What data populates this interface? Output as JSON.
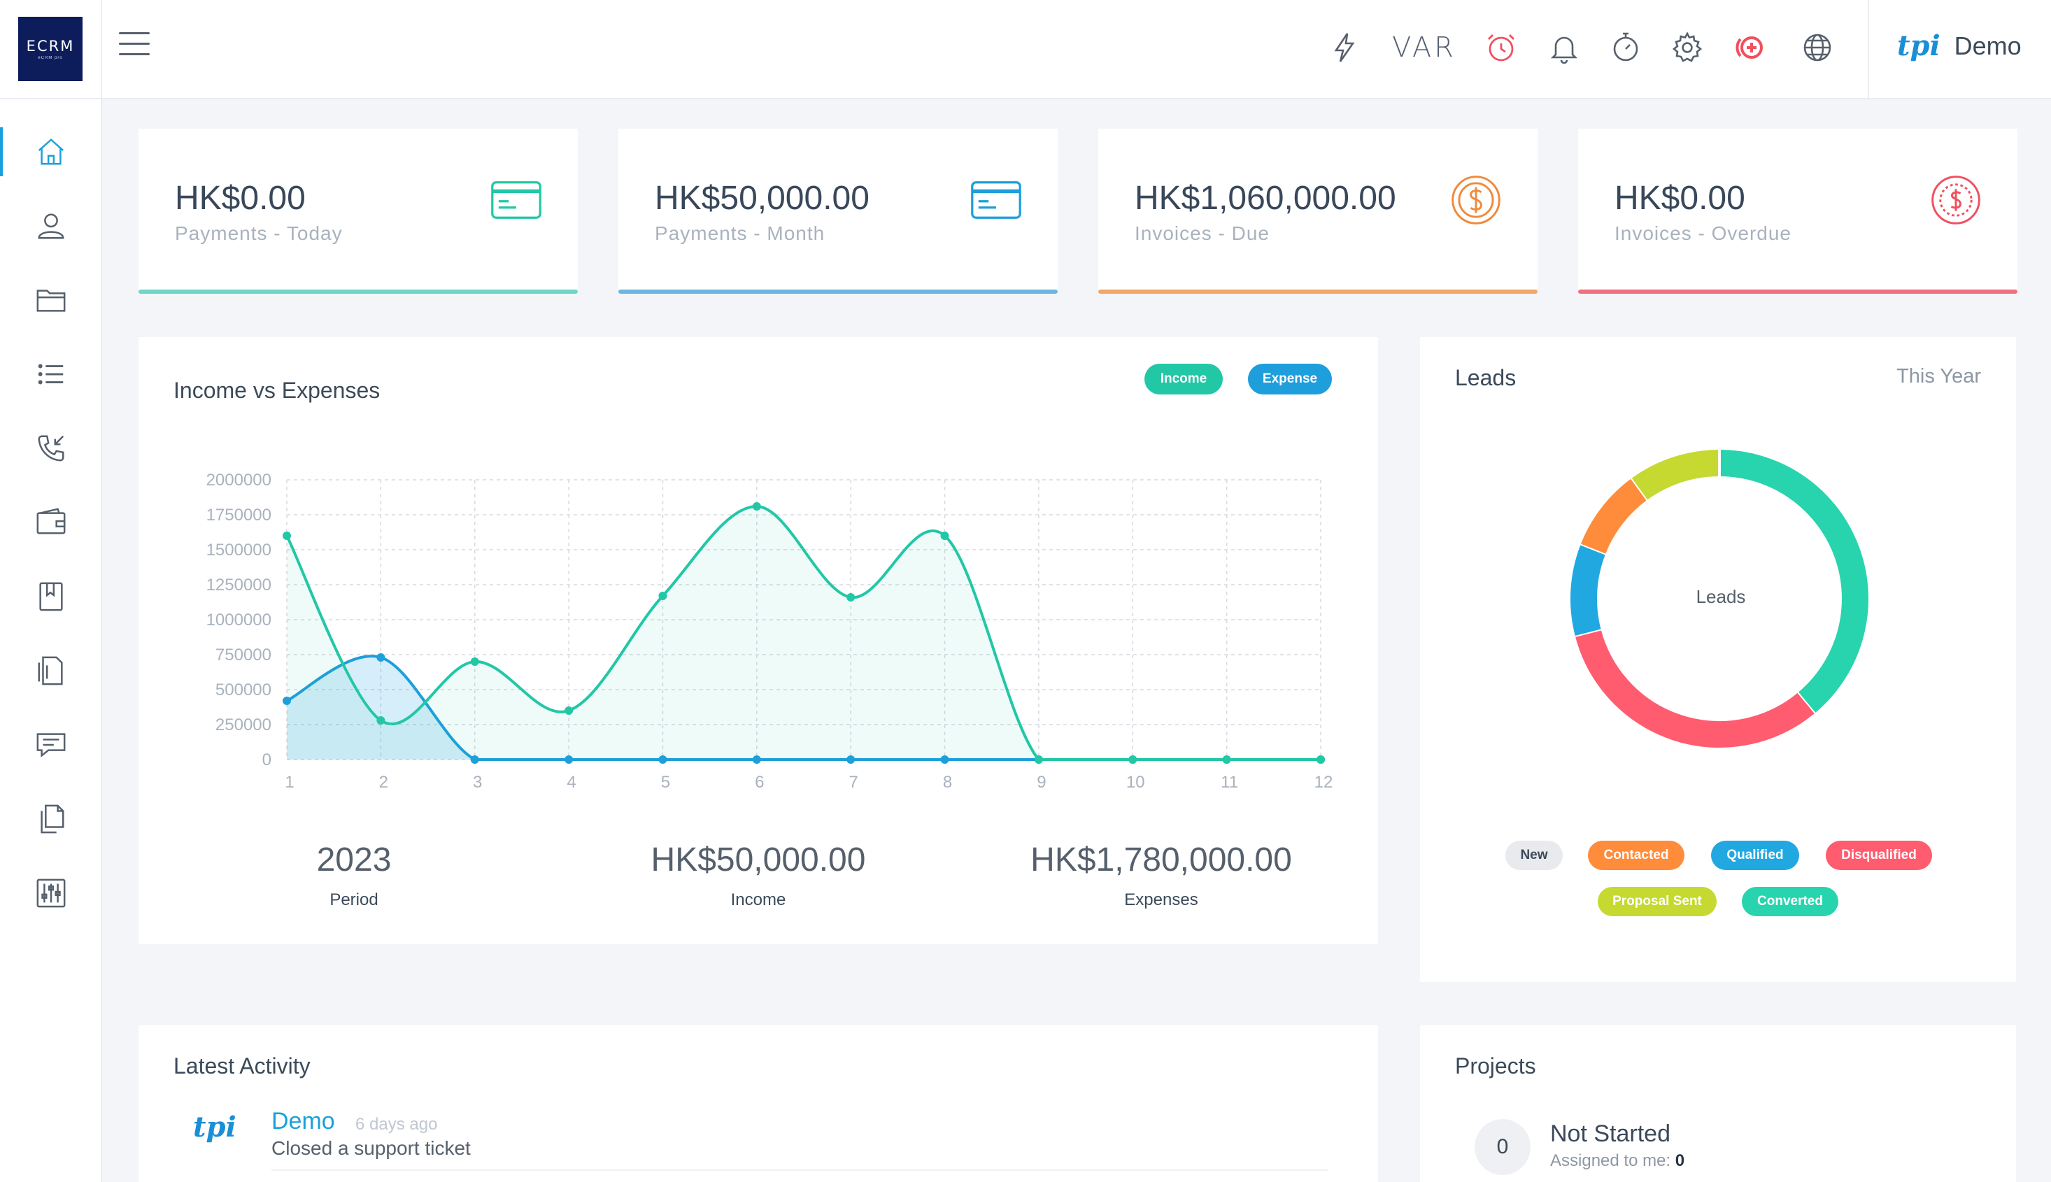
{
  "app": {
    "logo_text": "ECRM",
    "logo_subtext": "eCRM pro"
  },
  "topbar": {
    "icons": [
      "lightning-icon",
      "var-label",
      "alarm-clock-icon",
      "bell-icon",
      "stopwatch-icon",
      "gear-icon",
      "add-circle-icon",
      "globe-icon"
    ],
    "var_label": "VAR",
    "user_brand": "tpi",
    "user_name": "Demo"
  },
  "sidebar": {
    "items": [
      "home-icon",
      "user-icon",
      "folder-icon",
      "list-icon",
      "phone-icon",
      "wallet-icon",
      "bookmark-icon",
      "document-icon",
      "chat-icon",
      "files-icon",
      "settings-sliders-icon"
    ]
  },
  "stats": [
    {
      "value": "HK$0.00",
      "label": "Payments - Today",
      "color": "#6dd6c8",
      "icon": "credit-card-icon"
    },
    {
      "value": "HK$50,000.00",
      "label": "Payments - Month",
      "color": "#6ab8e0",
      "icon": "credit-card-icon"
    },
    {
      "value": "HK$1,060,000.00",
      "label": "Invoices - Due",
      "color": "#f2a766",
      "icon": "dollar-coin-icon"
    },
    {
      "value": "HK$0.00",
      "label": "Invoices - Overdue",
      "color": "#f0707e",
      "icon": "dollar-dashed-icon"
    }
  ],
  "income_chart": {
    "title": "Income vs Expenses",
    "legend_income": "Income",
    "legend_expense": "Expense",
    "summary": [
      {
        "value": "2023",
        "label": "Period"
      },
      {
        "value": "HK$50,000.00",
        "label": "Income"
      },
      {
        "value": "HK$1,780,000.00",
        "label": "Expenses"
      }
    ]
  },
  "chart_data": [
    {
      "type": "area",
      "title": "Income vs Expenses",
      "x": [
        1,
        2,
        3,
        4,
        5,
        6,
        7,
        8,
        9,
        10,
        11,
        12
      ],
      "y_ticks": [
        0,
        250000,
        500000,
        750000,
        1000000,
        1250000,
        1500000,
        1750000,
        2000000
      ],
      "ylim": [
        0,
        2000000
      ],
      "grid": true,
      "series": [
        {
          "name": "Income",
          "color": "#22c7a6",
          "values": [
            1600000,
            280000,
            700000,
            350000,
            1170000,
            1810000,
            1160000,
            1600000,
            0,
            0,
            0,
            0
          ]
        },
        {
          "name": "Expense",
          "color": "#1e9edb",
          "values": [
            420000,
            730000,
            0,
            0,
            0,
            0,
            0,
            0,
            0,
            0,
            0,
            0
          ]
        }
      ]
    },
    {
      "type": "pie",
      "title": "Leads",
      "center_label": "Leads",
      "categories": [
        "Converted",
        "Disqualified",
        "Qualified",
        "Contacted",
        "Proposal Sent",
        "New"
      ],
      "values": [
        39,
        32,
        10,
        9,
        10,
        0
      ],
      "colors": [
        "#27d4ad",
        "#ff5c6f",
        "#22a8e0",
        "#ff8c3b",
        "#c5d930",
        "#e8eaee"
      ]
    }
  ],
  "leads": {
    "title": "Leads",
    "period": "This Year",
    "center": "Leads",
    "legend": [
      {
        "label": "New",
        "color": "#e8eaee",
        "text_color": "#3b4a5a"
      },
      {
        "label": "Contacted",
        "color": "#ff8c3b",
        "text_color": "#ffffff"
      },
      {
        "label": "Qualified",
        "color": "#22a8e0",
        "text_color": "#ffffff"
      },
      {
        "label": "Disqualified",
        "color": "#ff5c6f",
        "text_color": "#ffffff"
      },
      {
        "label": "Proposal Sent",
        "color": "#c5d930",
        "text_color": "#ffffff"
      },
      {
        "label": "Converted",
        "color": "#27d4ad",
        "text_color": "#ffffff"
      }
    ]
  },
  "activity": {
    "title": "Latest Activity",
    "items": [
      {
        "brand": "tpi",
        "user": "Demo",
        "time": "6 days ago",
        "desc": "Closed a support ticket"
      }
    ]
  },
  "projects": {
    "title": "Projects",
    "items": [
      {
        "count": "0",
        "title": "Not Started",
        "sub_label": "Assigned to me:",
        "sub_value": "0"
      }
    ]
  }
}
